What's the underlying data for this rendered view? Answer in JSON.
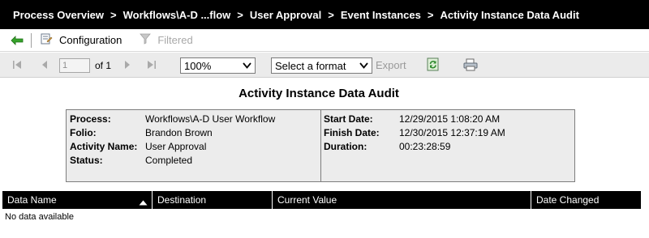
{
  "breadcrumb": {
    "items": [
      "Process Overview",
      "Workflows\\A-D ...flow",
      "User Approval",
      "Event Instances"
    ],
    "current": "Activity Instance Data Audit",
    "separator": ">"
  },
  "toolbar": {
    "back_icon": "back-arrow-icon",
    "configuration_label": "Configuration",
    "filtered_label": "Filtered"
  },
  "report_toolbar": {
    "page_value": "1",
    "page_of": "of 1",
    "zoom_value": "100%",
    "format_placeholder": "Select a format",
    "export_label": "Export"
  },
  "report": {
    "title": "Activity Instance Data Audit",
    "summary_left": [
      {
        "label": "Process:",
        "value": "Workflows\\A-D User Workflow"
      },
      {
        "label": "Folio:",
        "value": "Brandon Brown"
      },
      {
        "label": "Activity Name:",
        "value": "User Approval"
      },
      {
        "label": "Status:",
        "value": "Completed"
      }
    ],
    "summary_right": [
      {
        "label": "Start Date:",
        "value": "12/29/2015 1:08:20 AM"
      },
      {
        "label": "Finish Date:",
        "value": "12/30/2015 12:37:19 AM"
      },
      {
        "label": "Duration:",
        "value": "00:23:28:59"
      }
    ]
  },
  "table": {
    "columns": [
      "Data Name",
      "Destination",
      "Current Value",
      "Date Changed"
    ],
    "sort_column": "Data Name",
    "sort_direction": "ascending",
    "empty_message": "No data available"
  },
  "colors": {
    "header_bg": "#000000",
    "toolbar_bg": "#ebebeb",
    "summary_bg": "#ececec",
    "back_arrow": "#35a32a"
  }
}
